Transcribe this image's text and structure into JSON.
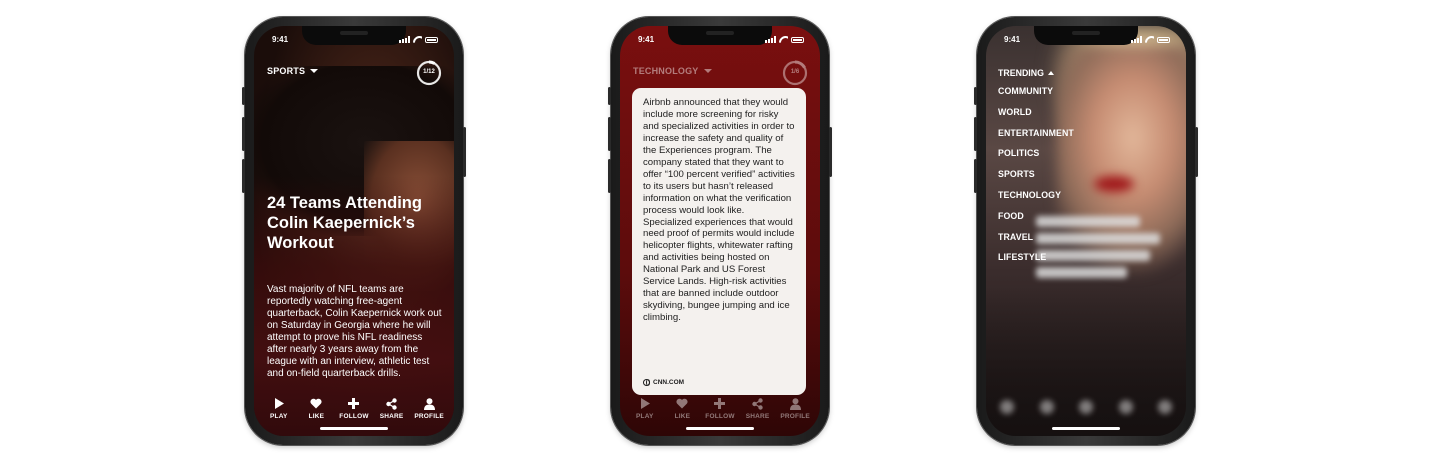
{
  "status_time": "9:41",
  "phones": [
    {
      "category": "SPORTS",
      "progress": "1/12",
      "progress_fraction": 0.0833,
      "title": "24 Teams Attending Colin Kaepernick’s Workout",
      "body": "Vast majority of NFL teams are reportedly watching free-agent quarterback, Colin Kaepernick work out on Saturday in Georgia where he will attempt to prove his NFL readiness after nearly 3 years away from the league with an interview, athletic test and on-field quarterback drills."
    },
    {
      "category": "TECHNOLOGY",
      "progress": "1/6",
      "progress_fraction": 0.1667,
      "card_text": "Airbnb announced that they would include more screening for risky and specialized activities in order to increase the safety and quality of the Experiences program. The company stated that they want to offer “100 percent verified” activities to its users but hasn’t released information on what the verification process would look like. Specialized experiences that would need proof of permits would include helicopter flights, whitewater rafting and activities being hosted on National Park and US Forest Service Lands. High-risk activities that are banned include outdoor skydiving, bungee jumping and ice climbing.",
      "source": "CNN.COM"
    },
    {
      "menu_header": "TRENDING",
      "menu_items": [
        "COMMUNITY",
        "WORLD",
        "ENTERTAINMENT",
        "POLITICS",
        "SPORTS",
        "TECHNOLOGY",
        "FOOD",
        "TRAVEL",
        "LIFESTYLE"
      ]
    }
  ],
  "actions": [
    {
      "label": "PLAY",
      "icon": "play-icon"
    },
    {
      "label": "LIKE",
      "icon": "heart-icon"
    },
    {
      "label": "FOLLOW",
      "icon": "plus-icon"
    },
    {
      "label": "SHARE",
      "icon": "share-icon"
    },
    {
      "label": "PROFILE",
      "icon": "user-icon"
    }
  ],
  "colors": {
    "sports_bg": "#4a1212",
    "technology_bg": "#6e0e0e",
    "card_bg": "#f4f1ee",
    "text": "#ffffff"
  }
}
